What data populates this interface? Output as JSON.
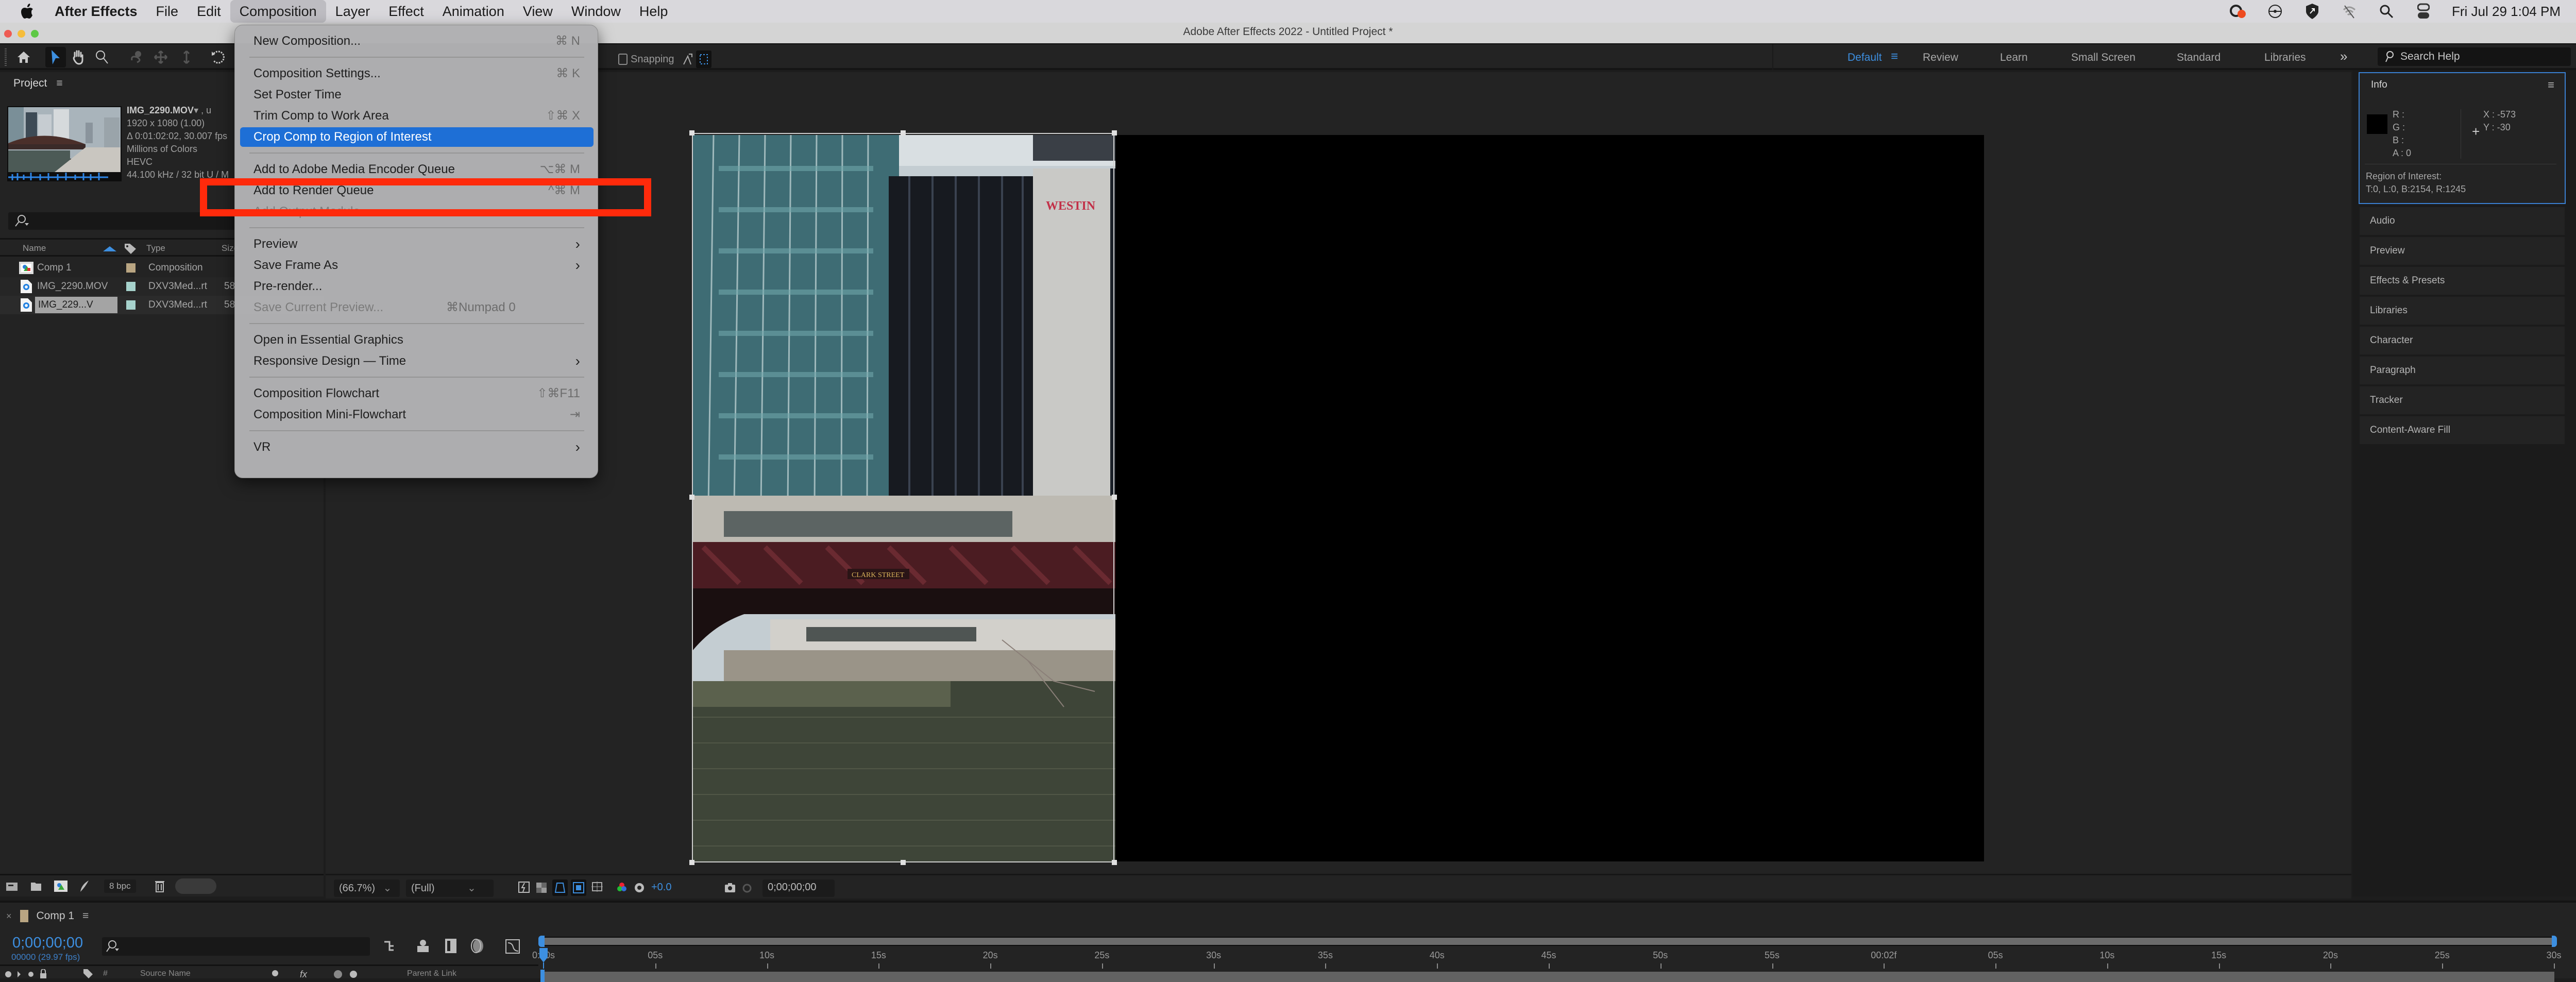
{
  "menubar": {
    "app": "After Effects",
    "items": [
      "File",
      "Edit",
      "Composition",
      "Layer",
      "Effect",
      "Animation",
      "View",
      "Window",
      "Help"
    ],
    "open_menu": "Composition",
    "status_icons": [
      "creative-cloud-icon",
      "network-radar-icon",
      "vpn-shield-icon",
      "wifi-off-icon",
      "spotlight-search-icon",
      "control-center-icon"
    ],
    "clock": "Fri Jul 29  1:04 PM"
  },
  "window": {
    "title": "Adobe After Effects 2022 - Untitled Project *"
  },
  "toolbar": {
    "tools": [
      "home",
      "selection",
      "hand",
      "zoom",
      "rotate-orbit",
      "pan-camera",
      "dolly-camera",
      "rotation"
    ],
    "snapping_label": "Snapping",
    "workspaces": [
      "Default",
      "Review",
      "Learn",
      "Small Screen",
      "Standard",
      "Libraries"
    ],
    "active_workspace": "Default",
    "overflow": "»",
    "search_placeholder": "Search Help"
  },
  "project": {
    "title": "Project",
    "selected_file": {
      "name": "IMG_2290.MOV",
      "name_suffix": "▾ , u",
      "dimensions": "1920 x 1080 (1.00)",
      "duration": "Δ 0:01:02:02, 30.007 fps",
      "colors": "Millions of Colors",
      "codec": "HEVC",
      "audio": "44.100 kHz / 32 bit U / M"
    },
    "columns": [
      "Name",
      "Type",
      "Size"
    ],
    "items": [
      {
        "name": "Comp 1",
        "type": "Composition",
        "size": "",
        "label_color": "#b9a582",
        "icon": "composition-icon"
      },
      {
        "name": "IMG_2290.MOV",
        "type": "DXV3Med...rt",
        "size": "58",
        "label_color": "#a6d2cc",
        "icon": "footage-file-icon"
      },
      {
        "name": "IMG_229...V",
        "type": "DXV3Med...rt",
        "size": "58",
        "label_color": "#a6d2cc",
        "icon": "footage-file-icon",
        "selected": true
      }
    ],
    "bpc": "8 bpc"
  },
  "viewer": {
    "zoom": "(66.7%)",
    "resolution": "(Full)",
    "exposure": "+0.0",
    "timecode": "0;00;00;00"
  },
  "info_panel": {
    "title": "Info",
    "r": "R :",
    "g": "G :",
    "b": "B :",
    "a": "A :   0",
    "x": "X :  -573",
    "y": "Y :  -30",
    "roi_label": "Region of Interest:",
    "roi_value": "T:0, L:0, B:2154, R:1245"
  },
  "right_panels": [
    "Audio",
    "Preview",
    "Effects & Presets",
    "Libraries",
    "Character",
    "Paragraph",
    "Tracker",
    "Content-Aware Fill"
  ],
  "timeline": {
    "comp_name": "Comp 1",
    "timecode": "0;00;00;00",
    "frame_fps": "00000 (29.97 fps)",
    "headers": [
      "#",
      "Source Name",
      "Parent & Link"
    ],
    "ticks": [
      "0:00s",
      "05s",
      "10s",
      "15s",
      "20s",
      "25s",
      "30s",
      "35s",
      "40s",
      "45s",
      "50s",
      "55s",
      "00:02f",
      "05s",
      "10s",
      "15s",
      "20s",
      "25s",
      "30s"
    ]
  },
  "composition_menu": {
    "items": [
      {
        "label": "New Composition...",
        "shortcut": "⌘ N"
      },
      {
        "sep": true
      },
      {
        "label": "Composition Settings...",
        "shortcut": "⌘ K"
      },
      {
        "label": "Set Poster Time",
        "shortcut": ""
      },
      {
        "label": "Trim Comp to Work Area",
        "shortcut": "⇧⌘ X"
      },
      {
        "label": "Crop Comp to Region of Interest",
        "shortcut": "",
        "selected": true
      },
      {
        "sep": true
      },
      {
        "label": "Add to Adobe Media Encoder Queue",
        "shortcut": "⌥⌘ M"
      },
      {
        "label": "Add to Render Queue",
        "shortcut": "^⌘ M"
      },
      {
        "label": "Add Output Module",
        "shortcut": "",
        "disabled": true
      },
      {
        "sep": true
      },
      {
        "label": "Preview",
        "submenu": true
      },
      {
        "label": "Save Frame As",
        "submenu": true
      },
      {
        "label": "Pre-render...",
        "shortcut": ""
      },
      {
        "label": "Save Current Preview...",
        "shortcut": "⌘Numpad 0",
        "disabled": true
      },
      {
        "sep": true
      },
      {
        "label": "Open in Essential Graphics",
        "shortcut": ""
      },
      {
        "label": "Responsive Design — Time",
        "submenu": true
      },
      {
        "sep": true
      },
      {
        "label": "Composition Flowchart",
        "shortcut": "⇧⌘F11"
      },
      {
        "label": "Composition Mini-Flowchart",
        "shortcut": "⇥"
      },
      {
        "sep": true
      },
      {
        "label": "VR",
        "submenu": true
      }
    ]
  },
  "annotation": {
    "highlighted_item": "Add to Render Queue",
    "color": "#ff2a0b"
  },
  "colors": {
    "accent": "#3d8fe0",
    "menu_highlight": "#1e6fd6",
    "panel_bg": "#232323"
  }
}
